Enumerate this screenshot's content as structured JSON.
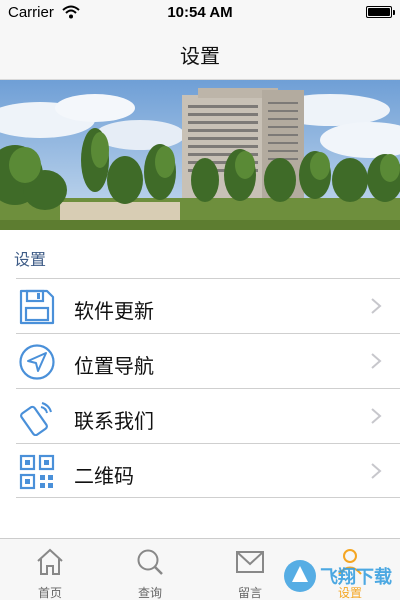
{
  "status_bar": {
    "carrier": "Carrier",
    "time": "10:54 AM",
    "wifi_icon": "wifi-icon",
    "battery_icon": "battery-icon"
  },
  "nav": {
    "title": "设置"
  },
  "banner": {
    "icon": "campus-building-photo"
  },
  "section": {
    "header": "设置"
  },
  "menu": {
    "items": [
      {
        "label": "软件更新",
        "icon": "floppy-disk-icon"
      },
      {
        "label": "位置导航",
        "icon": "location-arrow-icon"
      },
      {
        "label": "联系我们",
        "icon": "phone-call-icon"
      },
      {
        "label": "二维码",
        "icon": "qr-code-icon"
      }
    ]
  },
  "tabs": [
    {
      "label": "首页",
      "icon": "home-icon",
      "active": false
    },
    {
      "label": "查询",
      "icon": "search-icon",
      "active": false
    },
    {
      "label": "留言",
      "icon": "mail-icon",
      "active": false
    },
    {
      "label": "设置",
      "icon": "settings-icon",
      "active": true
    }
  ],
  "watermark": {
    "text": "飞翔下载"
  },
  "colors": {
    "accent_blue": "#4a90d9",
    "tab_active": "#f5a623",
    "section_header": "#3d5b86",
    "bar_bg": "#f7f7f7"
  }
}
